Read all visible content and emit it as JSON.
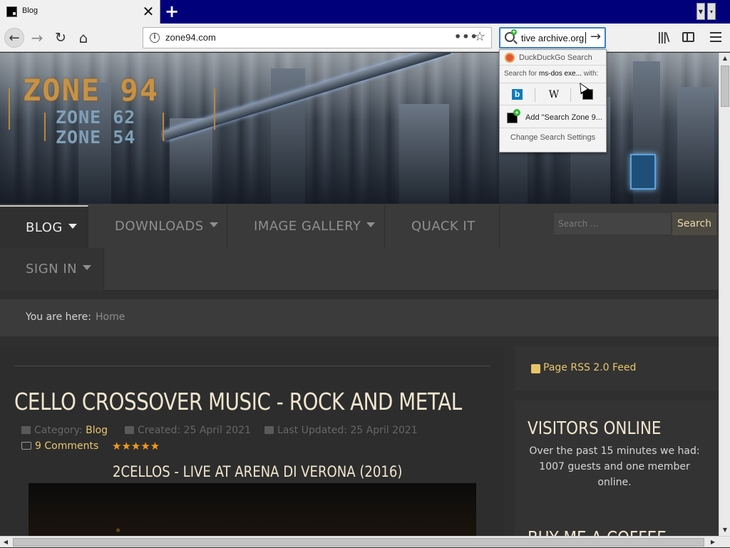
{
  "browser": {
    "tab": {
      "title": "Blog",
      "close_glyph": "✕",
      "favicon": "zone94-favicon"
    },
    "new_tab_glyph": "+",
    "tab_scroll": {
      "left_glyph": "▼",
      "right_glyph": "▾"
    },
    "nav": {
      "back_glyph": "←",
      "forward_glyph": "→",
      "reload_glyph": "↻",
      "home_glyph": "⌂"
    },
    "url": "zone94.com",
    "info_glyph": "i",
    "page_actions_glyph": "•••",
    "bookmark_glyph": "☆",
    "search_box": {
      "value": "tive archive.org",
      "go_glyph": "→"
    },
    "library_glyph": "|||\\"
  },
  "search_popup": {
    "ddg_label": "DuckDuckGo Search",
    "search_for_prefix": "Search for ",
    "search_for_term": "ms-dos exe...",
    "search_for_suffix": " with:",
    "engines": [
      {
        "name": "bing",
        "glyph": "b"
      },
      {
        "name": "wikipedia",
        "glyph": "W"
      },
      {
        "name": "zone94",
        "glyph": ""
      }
    ],
    "add_label": "Add \"Search Zone 9...",
    "settings_label": "Change Search Settings"
  },
  "site": {
    "logo": {
      "main": "ZONE 94",
      "sub1": "ZONE 62",
      "sub2": "ZONE 54"
    },
    "menu": [
      {
        "label": "BLOG",
        "has_caret": true,
        "active": true
      },
      {
        "label": "DOWNLOADS",
        "has_caret": true
      },
      {
        "label": "IMAGE GALLERY",
        "has_caret": true
      },
      {
        "label": "QUACK IT",
        "has_caret": false
      },
      {
        "label": "SIGN IN",
        "has_caret": true
      }
    ],
    "search": {
      "placeholder": "Search ...",
      "button": "Search"
    },
    "breadcrumb": {
      "label": "You are here:",
      "home": "Home"
    }
  },
  "article": {
    "title": "CELLO CROSSOVER MUSIC - ROCK AND METAL",
    "category_label": "Category: ",
    "category": "Blog",
    "created": "Created: 25 April 2021",
    "updated": "Last Updated: 25 April 2021",
    "comments": "9 Comments",
    "rating": "★★★★★",
    "rating_value": 5,
    "video_title": "2CELLOS - LIVE AT ARENA DI VERONA (2016)"
  },
  "sidebar": {
    "rss": "Page RSS 2.0 Feed",
    "visitors_title": "VISITORS ONLINE",
    "visitors_text": "Over the past 15 minutes we had: 1007 guests and one member online.",
    "coffee_title": "BUY ME A COFFEE"
  },
  "scrollbars": {
    "up_glyph": "▲",
    "down_glyph": "▼",
    "left_glyph": "◀",
    "right_glyph": "▶"
  },
  "colors": {
    "accent": "#e7c66a",
    "title": "#f0e6cf",
    "tabbar": "#00007a",
    "searchbar_focus": "#3c80c8"
  }
}
